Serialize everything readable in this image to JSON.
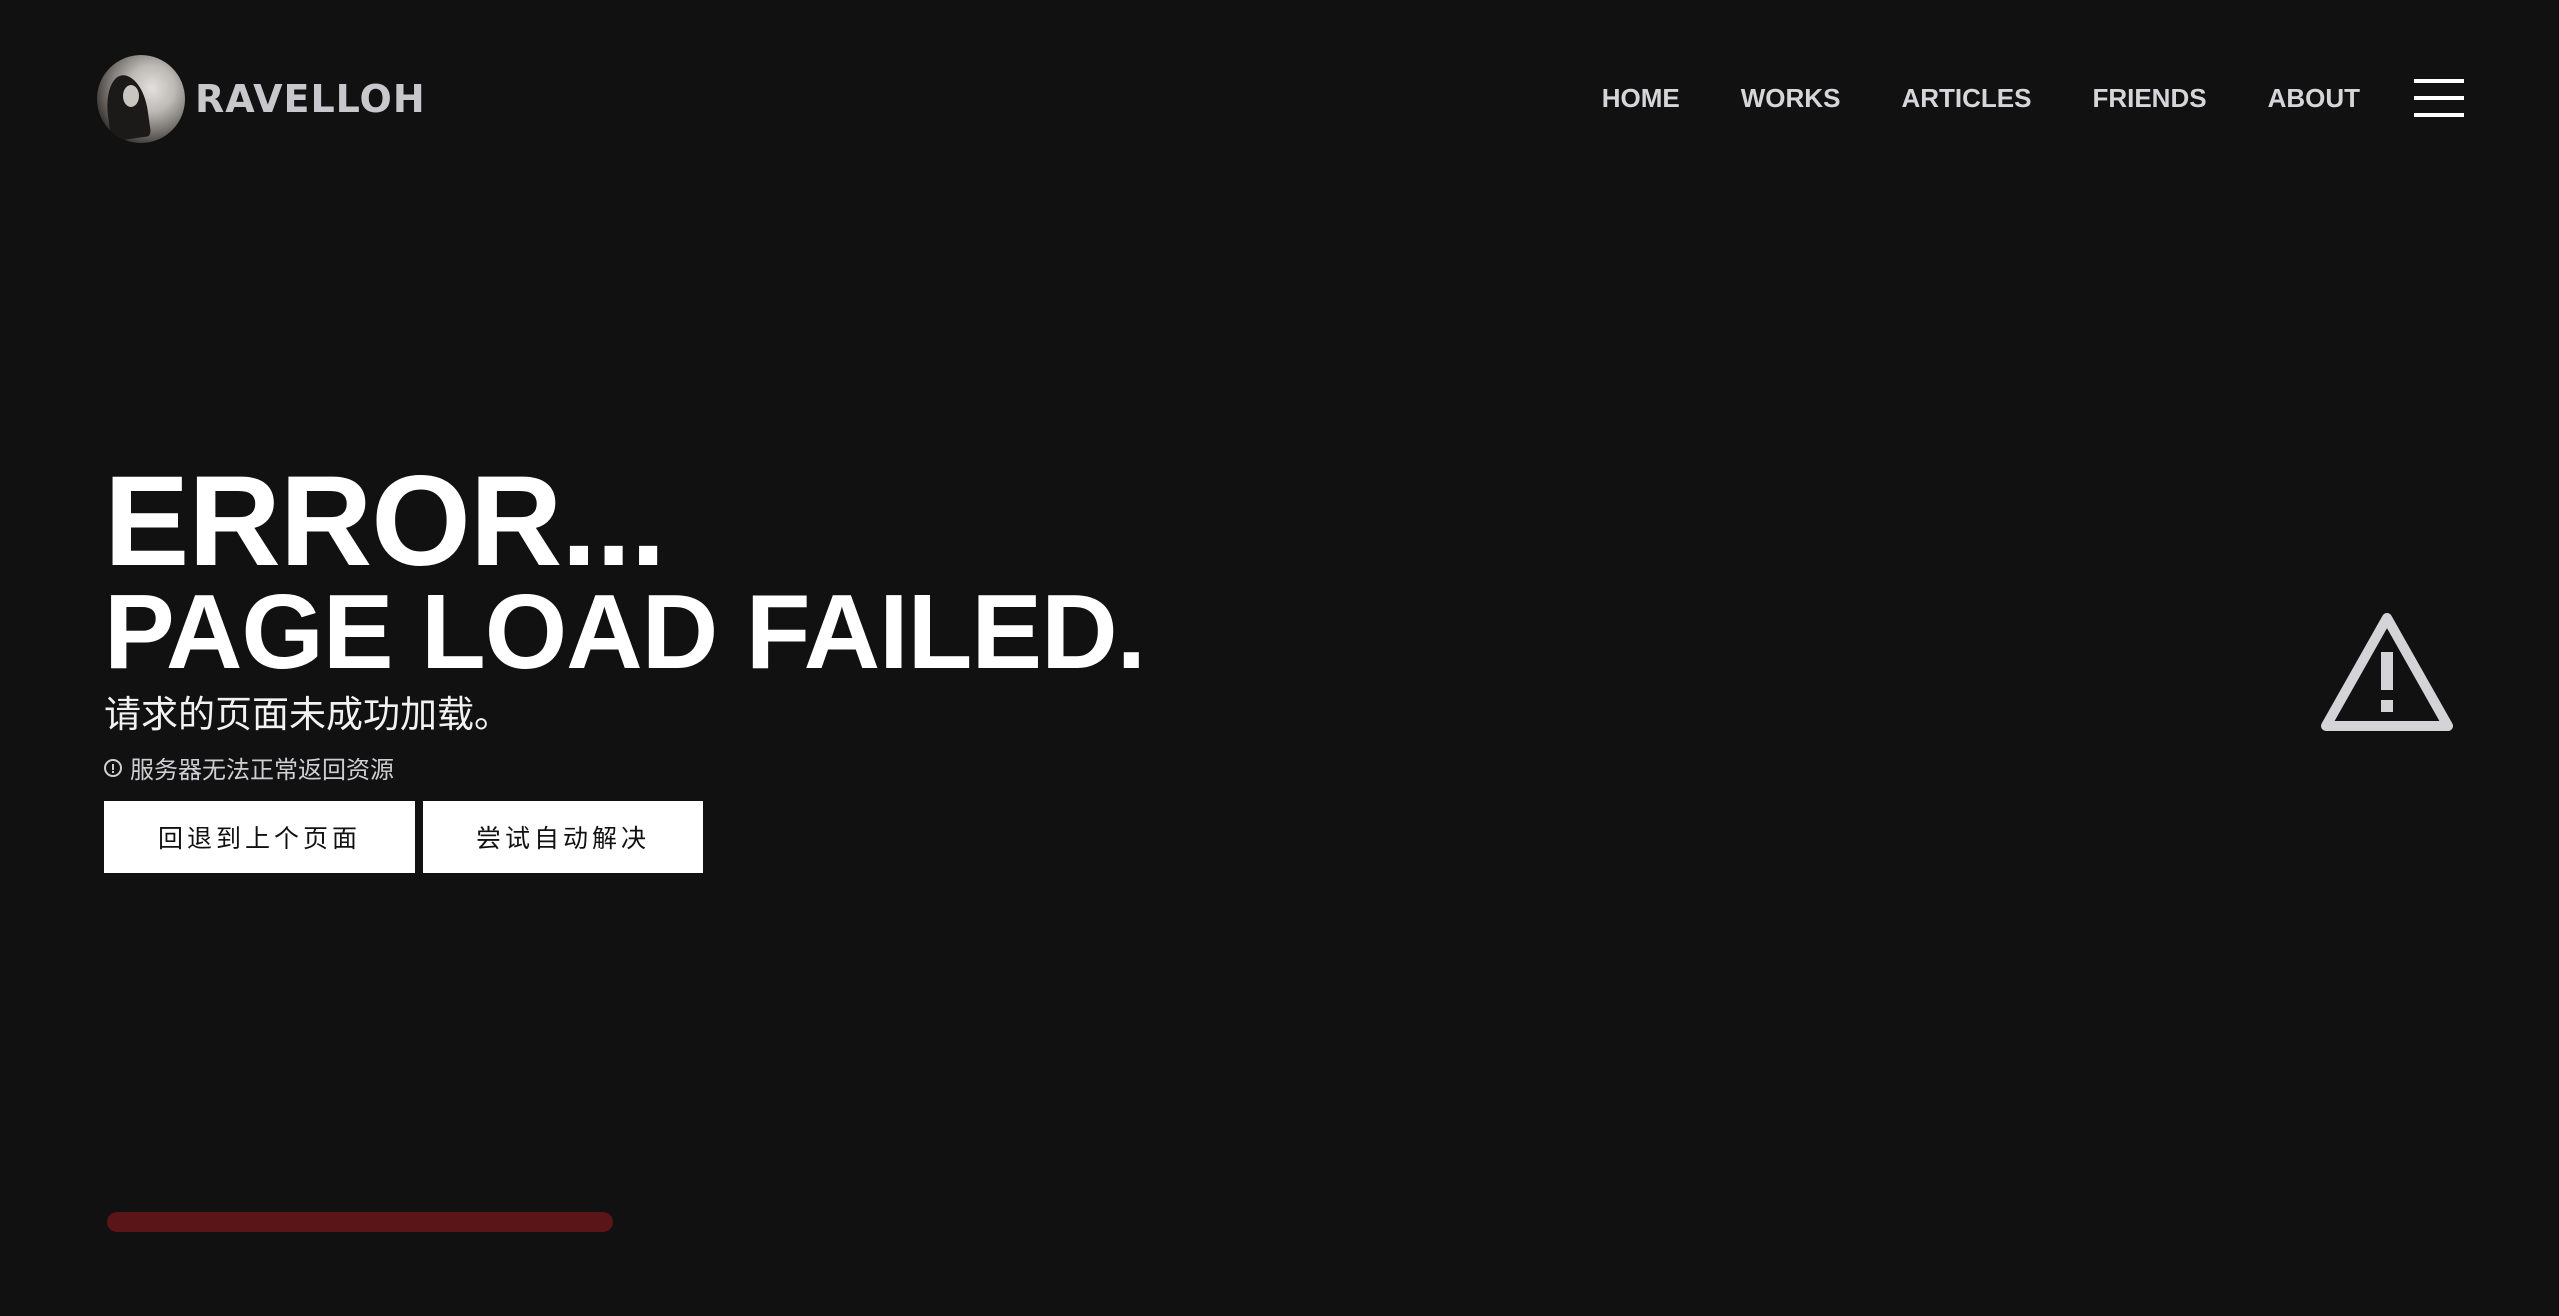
{
  "brand": {
    "name": "RAVELLOH"
  },
  "nav": {
    "items": [
      "HOME",
      "WORKS",
      "ARTICLES",
      "FRIENDS",
      "ABOUT"
    ]
  },
  "hero": {
    "title": "ERROR...",
    "subtitle": "PAGE LOAD FAILED.",
    "message_cn": "请求的页面未成功加载。",
    "note": "服务器无法正常返回资源",
    "buttons": {
      "back": "回退到上个页面",
      "auto_fix": "尝试自动解决"
    }
  },
  "icons": {
    "menu": "hamburger-menu-icon",
    "info": "info-circle-icon",
    "warning": "warning-triangle-icon"
  },
  "progress": {
    "fraction": 1.0
  },
  "colors": {
    "background": "#111112",
    "text": "#ffffff",
    "nav_text": "#d6d6da",
    "button_bg": "#ffffff",
    "warning_icon": "#d4d4d8",
    "progress": "#5a1519"
  }
}
